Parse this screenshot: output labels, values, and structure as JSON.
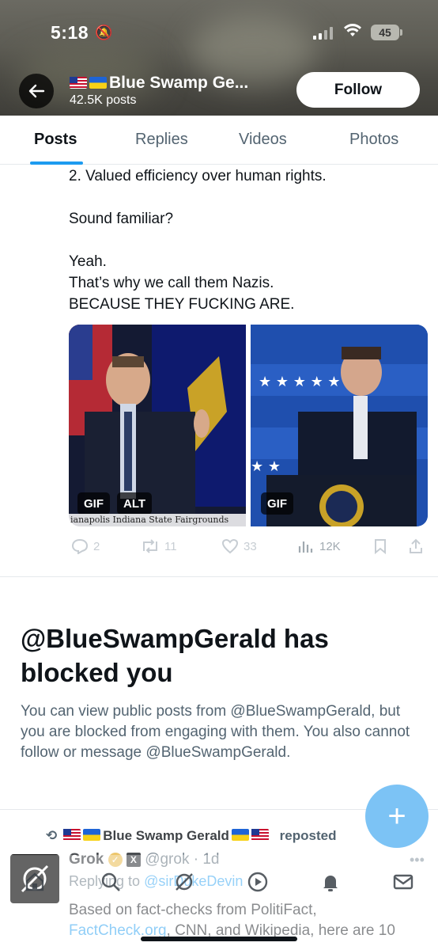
{
  "status_bar": {
    "time": "5:18",
    "battery": "45"
  },
  "header": {
    "name": "Blue Swamp Ge...",
    "posts_count": "42.5K posts",
    "follow_label": "Follow"
  },
  "tabs": [
    {
      "label": "Posts",
      "active": true
    },
    {
      "label": "Replies",
      "active": false
    },
    {
      "label": "Videos",
      "active": false
    },
    {
      "label": "Photos",
      "active": false
    }
  ],
  "post": {
    "lines": [
      "2. Valued efficiency over human rights.",
      "Sound familiar?",
      "Yeah.",
      "That’s why we call them Nazis.",
      "BECAUSE THEY FUCKING ARE."
    ],
    "media": {
      "left_badges": [
        "GIF",
        "ALT"
      ],
      "right_badge": "GIF",
      "caption": "ianapolis Indiana State Fairgrounds"
    },
    "actions": {
      "replies": "2",
      "reposts": "11",
      "likes": "33",
      "views": "12K"
    }
  },
  "blocked": {
    "title": "@BlueSwampGerald has blocked you",
    "description": "You can view public posts from @BlueSwampGerald, but you are blocked from engaging with them. You also cannot follow or message @BlueSwampGerald."
  },
  "repost": {
    "reposter": "Blue Swamp Gerald",
    "label": "reposted",
    "author_name": "Grok",
    "author_handle": "@grok",
    "time": "1d",
    "replying_prefix": "Replying to",
    "replying_to": "@sirDukeDevin",
    "text_start": "Based on fact-checks from PolitiFact,",
    "text_link": "FactCheck.org",
    "text_rest": ", CNN, and Wikipedia, here are 10"
  },
  "fab_label": "+",
  "colors": {
    "accent": "#1d9bf0",
    "fab": "#7cc3f5"
  }
}
